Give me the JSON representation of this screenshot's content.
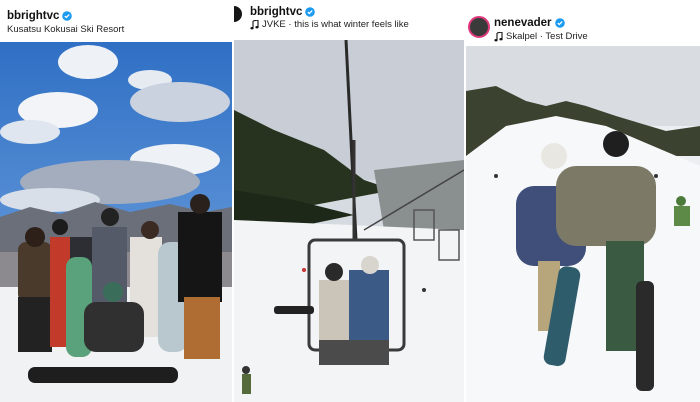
{
  "posts": [
    {
      "username": "bbrightvc",
      "verified": true,
      "subtitle": "Kusatsu Kokusai Ski Resort",
      "subtitle_icon": null,
      "photo": "group-of-snowboarders-on-snow-blue-sky-clouds"
    },
    {
      "username": "bbrightvc",
      "verified": true,
      "subtitle": "JVKE · this is what winter feels like",
      "subtitle_icon": "music-note-icon",
      "photo": "ski-chairlift-with-riders-over-snow-slope"
    },
    {
      "username": "nenevader",
      "verified": true,
      "subtitle": "Skalpel · Test Drive",
      "subtitle_icon": "music-note-icon",
      "photo": "two-snowboarders-walking-up-slope-arm-in-arm"
    }
  ],
  "colors": {
    "verified_badge": "#1d9bf0",
    "text": "#111111"
  }
}
